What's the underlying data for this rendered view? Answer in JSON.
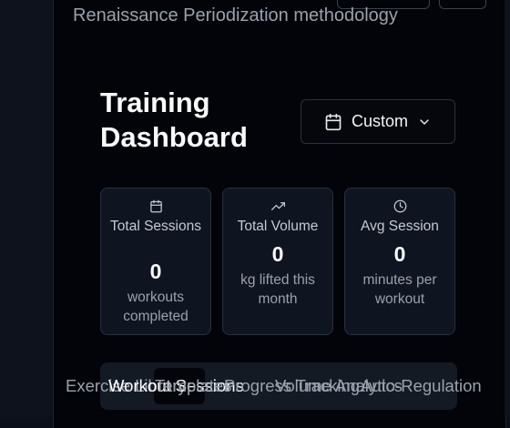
{
  "header": {
    "subtitle": "Renaissance Periodization methodology"
  },
  "dashboard": {
    "title": "Training Dashboard",
    "date_range": {
      "value": "Custom",
      "icon": "calendar-icon",
      "caret": "chevron-down-icon"
    }
  },
  "stats": [
    {
      "icon": "calendar-icon",
      "label": "Total Sessions",
      "value": "0",
      "description": "workouts completed"
    },
    {
      "icon": "trending-up-icon",
      "label": "Total Volume",
      "value": "0",
      "description": "kg lifted this month"
    },
    {
      "icon": "clock-icon",
      "label": "Avg Session",
      "value": "0",
      "description": "minutes per workout"
    }
  ],
  "tabs": [
    {
      "label": "Exercise Library",
      "active": false
    },
    {
      "label": "Workout Sessions",
      "active": true
    },
    {
      "label": "Templates",
      "active": false
    },
    {
      "label": "Progress Tracking",
      "active": false
    },
    {
      "label": "Volume Analytics",
      "active": false
    },
    {
      "label": "Auto-Regulation",
      "active": false
    }
  ],
  "colors": {
    "background": "#020409",
    "card": "#0f1520",
    "border": "#263042",
    "text": "#f3f4f6",
    "muted": "#9aa1ad"
  }
}
